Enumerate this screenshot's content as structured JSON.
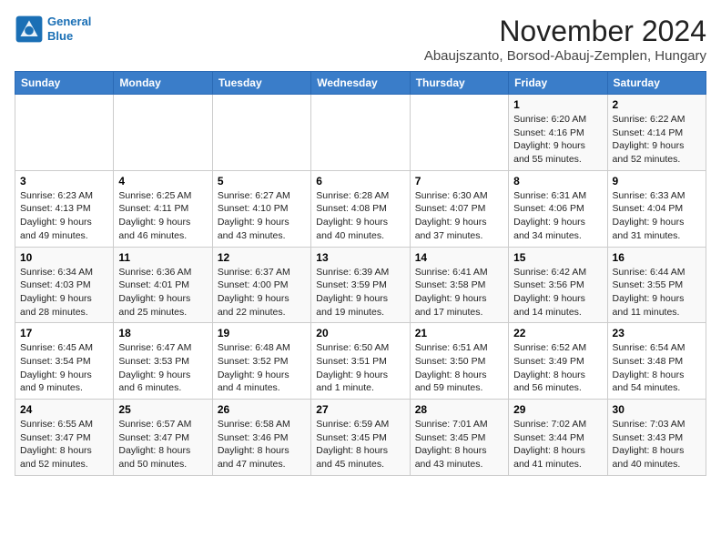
{
  "logo": {
    "line1": "General",
    "line2": "Blue"
  },
  "title": "November 2024",
  "subtitle": "Abaujszanto, Borsod-Abauj-Zemplen, Hungary",
  "weekdays": [
    "Sunday",
    "Monday",
    "Tuesday",
    "Wednesday",
    "Thursday",
    "Friday",
    "Saturday"
  ],
  "weeks": [
    [
      {
        "day": "",
        "info": ""
      },
      {
        "day": "",
        "info": ""
      },
      {
        "day": "",
        "info": ""
      },
      {
        "day": "",
        "info": ""
      },
      {
        "day": "",
        "info": ""
      },
      {
        "day": "1",
        "info": "Sunrise: 6:20 AM\nSunset: 4:16 PM\nDaylight: 9 hours and 55 minutes."
      },
      {
        "day": "2",
        "info": "Sunrise: 6:22 AM\nSunset: 4:14 PM\nDaylight: 9 hours and 52 minutes."
      }
    ],
    [
      {
        "day": "3",
        "info": "Sunrise: 6:23 AM\nSunset: 4:13 PM\nDaylight: 9 hours and 49 minutes."
      },
      {
        "day": "4",
        "info": "Sunrise: 6:25 AM\nSunset: 4:11 PM\nDaylight: 9 hours and 46 minutes."
      },
      {
        "day": "5",
        "info": "Sunrise: 6:27 AM\nSunset: 4:10 PM\nDaylight: 9 hours and 43 minutes."
      },
      {
        "day": "6",
        "info": "Sunrise: 6:28 AM\nSunset: 4:08 PM\nDaylight: 9 hours and 40 minutes."
      },
      {
        "day": "7",
        "info": "Sunrise: 6:30 AM\nSunset: 4:07 PM\nDaylight: 9 hours and 37 minutes."
      },
      {
        "day": "8",
        "info": "Sunrise: 6:31 AM\nSunset: 4:06 PM\nDaylight: 9 hours and 34 minutes."
      },
      {
        "day": "9",
        "info": "Sunrise: 6:33 AM\nSunset: 4:04 PM\nDaylight: 9 hours and 31 minutes."
      }
    ],
    [
      {
        "day": "10",
        "info": "Sunrise: 6:34 AM\nSunset: 4:03 PM\nDaylight: 9 hours and 28 minutes."
      },
      {
        "day": "11",
        "info": "Sunrise: 6:36 AM\nSunset: 4:01 PM\nDaylight: 9 hours and 25 minutes."
      },
      {
        "day": "12",
        "info": "Sunrise: 6:37 AM\nSunset: 4:00 PM\nDaylight: 9 hours and 22 minutes."
      },
      {
        "day": "13",
        "info": "Sunrise: 6:39 AM\nSunset: 3:59 PM\nDaylight: 9 hours and 19 minutes."
      },
      {
        "day": "14",
        "info": "Sunrise: 6:41 AM\nSunset: 3:58 PM\nDaylight: 9 hours and 17 minutes."
      },
      {
        "day": "15",
        "info": "Sunrise: 6:42 AM\nSunset: 3:56 PM\nDaylight: 9 hours and 14 minutes."
      },
      {
        "day": "16",
        "info": "Sunrise: 6:44 AM\nSunset: 3:55 PM\nDaylight: 9 hours and 11 minutes."
      }
    ],
    [
      {
        "day": "17",
        "info": "Sunrise: 6:45 AM\nSunset: 3:54 PM\nDaylight: 9 hours and 9 minutes."
      },
      {
        "day": "18",
        "info": "Sunrise: 6:47 AM\nSunset: 3:53 PM\nDaylight: 9 hours and 6 minutes."
      },
      {
        "day": "19",
        "info": "Sunrise: 6:48 AM\nSunset: 3:52 PM\nDaylight: 9 hours and 4 minutes."
      },
      {
        "day": "20",
        "info": "Sunrise: 6:50 AM\nSunset: 3:51 PM\nDaylight: 9 hours and 1 minute."
      },
      {
        "day": "21",
        "info": "Sunrise: 6:51 AM\nSunset: 3:50 PM\nDaylight: 8 hours and 59 minutes."
      },
      {
        "day": "22",
        "info": "Sunrise: 6:52 AM\nSunset: 3:49 PM\nDaylight: 8 hours and 56 minutes."
      },
      {
        "day": "23",
        "info": "Sunrise: 6:54 AM\nSunset: 3:48 PM\nDaylight: 8 hours and 54 minutes."
      }
    ],
    [
      {
        "day": "24",
        "info": "Sunrise: 6:55 AM\nSunset: 3:47 PM\nDaylight: 8 hours and 52 minutes."
      },
      {
        "day": "25",
        "info": "Sunrise: 6:57 AM\nSunset: 3:47 PM\nDaylight: 8 hours and 50 minutes."
      },
      {
        "day": "26",
        "info": "Sunrise: 6:58 AM\nSunset: 3:46 PM\nDaylight: 8 hours and 47 minutes."
      },
      {
        "day": "27",
        "info": "Sunrise: 6:59 AM\nSunset: 3:45 PM\nDaylight: 8 hours and 45 minutes."
      },
      {
        "day": "28",
        "info": "Sunrise: 7:01 AM\nSunset: 3:45 PM\nDaylight: 8 hours and 43 minutes."
      },
      {
        "day": "29",
        "info": "Sunrise: 7:02 AM\nSunset: 3:44 PM\nDaylight: 8 hours and 41 minutes."
      },
      {
        "day": "30",
        "info": "Sunrise: 7:03 AM\nSunset: 3:43 PM\nDaylight: 8 hours and 40 minutes."
      }
    ]
  ]
}
